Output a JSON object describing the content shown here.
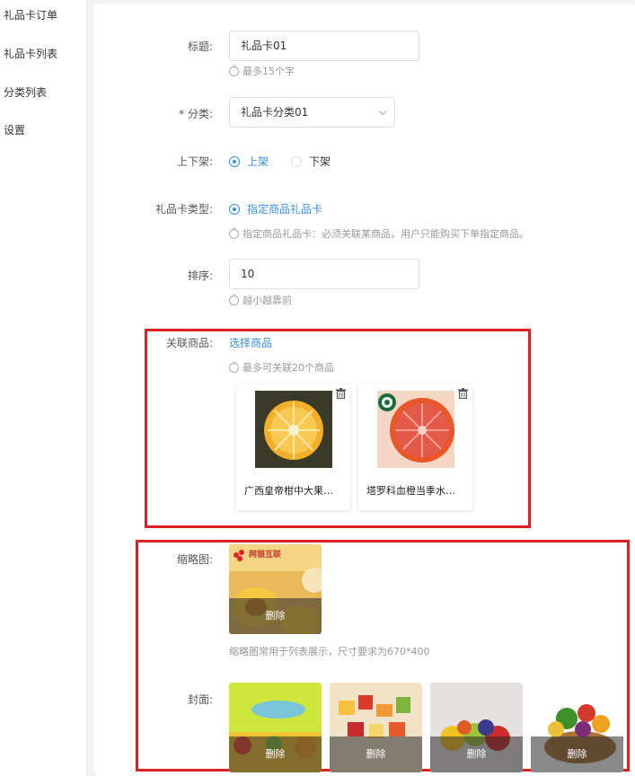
{
  "sidebar": {
    "items": [
      {
        "label": "礼品卡订单"
      },
      {
        "label": "礼品卡列表"
      },
      {
        "label": "分类列表"
      },
      {
        "label": "设置"
      }
    ]
  },
  "form": {
    "title": {
      "label": "标题:",
      "value": "礼品卡01",
      "hint": "最多15个字"
    },
    "category": {
      "label": "* 分类:",
      "value": "礼品卡分类01"
    },
    "shelf": {
      "label": "上下架:",
      "options": [
        "上架",
        "下架"
      ],
      "selected": "上架"
    },
    "card_type": {
      "label": "礼品卡类型:",
      "option": "指定商品礼品卡",
      "hint": "指定商品礼品卡：必须关联某商品，用户只能购买下单指定商品。"
    },
    "sort": {
      "label": "排序:",
      "value": "10",
      "hint": "越小越靠前"
    },
    "products": {
      "label": "关联商品:",
      "select_link": "选择商品",
      "hint": "最多可关联20个商品",
      "items": [
        {
          "title": "广西皇帝柑中大果…",
          "image": "orange-peeled"
        },
        {
          "title": "塔罗科血橙当季水…",
          "image": "blood-orange"
        }
      ]
    },
    "thumbnail": {
      "label": "缩略图:",
      "delete_label": "删除",
      "hint": "缩略图常用于列表展示，尺寸要求为670*400",
      "logo_text": "网银互联"
    },
    "cover": {
      "label": "封面:",
      "delete_label": "删除",
      "images": [
        "fruit-splash",
        "fruit-salad",
        "fruit-plate",
        "vegetable-basket"
      ]
    }
  },
  "colors": {
    "accent": "#3a8ee6",
    "highlight": "#e02020"
  }
}
